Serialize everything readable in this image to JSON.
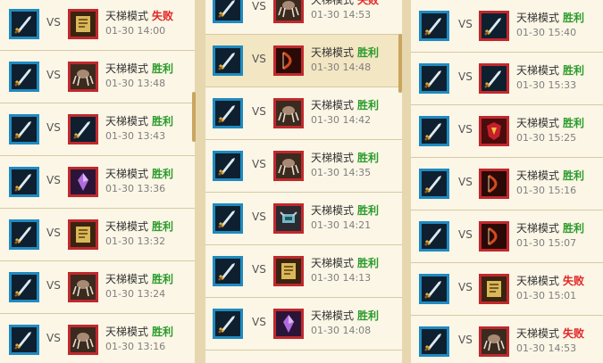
{
  "columns": [
    {
      "rows": [
        {
          "vs": "VS",
          "mode": "天梯模式",
          "result": "失败",
          "outcome": "loss",
          "time": "01-30 14:00",
          "opponent": "scroll-icon"
        },
        {
          "vs": "VS",
          "mode": "天梯模式",
          "result": "胜利",
          "outcome": "win",
          "time": "01-30 13:48",
          "opponent": "spider-icon"
        },
        {
          "vs": "VS",
          "mode": "天梯模式",
          "result": "胜利",
          "outcome": "win",
          "time": "01-30 13:43",
          "opponent": "sword-icon"
        },
        {
          "vs": "VS",
          "mode": "天梯模式",
          "result": "胜利",
          "outcome": "win",
          "time": "01-30 13:36",
          "opponent": "purple-crystal-icon"
        },
        {
          "vs": "VS",
          "mode": "天梯模式",
          "result": "胜利",
          "outcome": "win",
          "time": "01-30 13:32",
          "opponent": "scroll-icon"
        },
        {
          "vs": "VS",
          "mode": "天梯模式",
          "result": "胜利",
          "outcome": "win",
          "time": "01-30 13:24",
          "opponent": "spider-icon"
        },
        {
          "vs": "VS",
          "mode": "天梯模式",
          "result": "胜利",
          "outcome": "win",
          "time": "01-30 13:16",
          "opponent": "spider-icon"
        }
      ]
    },
    {
      "rows": [
        {
          "vs": "VS",
          "mode": "天梯模式",
          "result": "失败",
          "outcome": "loss",
          "time": "01-30 14:53",
          "opponent": "spider-icon"
        },
        {
          "vs": "VS",
          "mode": "天梯模式",
          "result": "胜利",
          "outcome": "win",
          "time": "01-30 14:48",
          "opponent": "bow-icon"
        },
        {
          "vs": "VS",
          "mode": "天梯模式",
          "result": "胜利",
          "outcome": "win",
          "time": "01-30 14:42",
          "opponent": "spider-icon"
        },
        {
          "vs": "VS",
          "mode": "天梯模式",
          "result": "胜利",
          "outcome": "win",
          "time": "01-30 14:35",
          "opponent": "spider-icon"
        },
        {
          "vs": "VS",
          "mode": "天梯模式",
          "result": "胜利",
          "outcome": "win",
          "time": "01-30 14:21",
          "opponent": "mech-icon"
        },
        {
          "vs": "VS",
          "mode": "天梯模式",
          "result": "胜利",
          "outcome": "win",
          "time": "01-30 14:13",
          "opponent": "scroll-icon"
        },
        {
          "vs": "VS",
          "mode": "天梯模式",
          "result": "胜利",
          "outcome": "win",
          "time": "01-30 14:08",
          "opponent": "purple-crystal-icon"
        }
      ]
    },
    {
      "rows": [
        {
          "vs": "VS",
          "mode": "天梯模式",
          "result": "胜利",
          "outcome": "win",
          "time": "01-30 15:40",
          "opponent": "sword-icon"
        },
        {
          "vs": "VS",
          "mode": "天梯模式",
          "result": "胜利",
          "outcome": "win",
          "time": "01-30 15:33",
          "opponent": "sword-icon"
        },
        {
          "vs": "VS",
          "mode": "天梯模式",
          "result": "胜利",
          "outcome": "win",
          "time": "01-30 15:25",
          "opponent": "rune-icon"
        },
        {
          "vs": "VS",
          "mode": "天梯模式",
          "result": "胜利",
          "outcome": "win",
          "time": "01-30 15:16",
          "opponent": "bow-icon"
        },
        {
          "vs": "VS",
          "mode": "天梯模式",
          "result": "胜利",
          "outcome": "win",
          "time": "01-30 15:07",
          "opponent": "bow-icon"
        },
        {
          "vs": "VS",
          "mode": "天梯模式",
          "result": "失败",
          "outcome": "loss",
          "time": "01-30 15:01",
          "opponent": "scroll-icon"
        },
        {
          "vs": "VS",
          "mode": "天梯模式",
          "result": "失败",
          "outcome": "loss",
          "time": "01-30 14:53",
          "opponent": "spider-icon"
        }
      ]
    }
  ],
  "colors": {
    "win": "#2b9b2b",
    "loss": "#e02424",
    "player_frame": "#1f8ac0",
    "opponent_frame": "#c0282d"
  }
}
